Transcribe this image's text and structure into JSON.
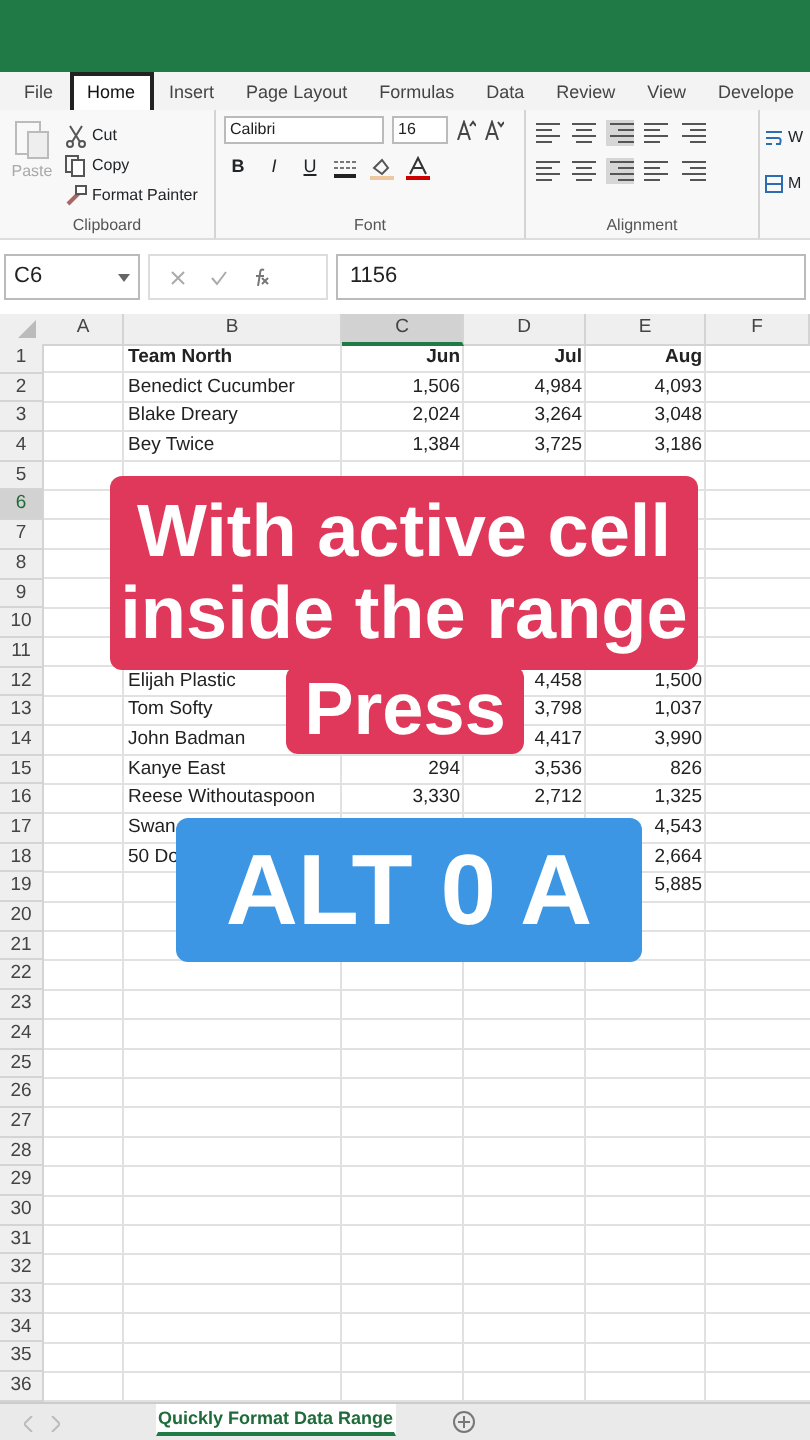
{
  "menu_tabs": [
    {
      "label": "File",
      "selected": false
    },
    {
      "label": "Home",
      "selected": true
    },
    {
      "label": "Insert",
      "selected": false
    },
    {
      "label": "Page Layout",
      "selected": false
    },
    {
      "label": "Formulas",
      "selected": false
    },
    {
      "label": "Data",
      "selected": false
    },
    {
      "label": "Review",
      "selected": false
    },
    {
      "label": "View",
      "selected": false
    },
    {
      "label": "Develope",
      "selected": false
    }
  ],
  "ribbon": {
    "clipboard": {
      "paste": {
        "label": "Paste",
        "disabled": true
      },
      "commands": [
        "Cut",
        "Copy",
        "Format Painter"
      ],
      "label": "Clipboard"
    },
    "font": {
      "font_name": "Calibri",
      "font_size": "16",
      "style_buttons": [
        "B",
        "I",
        "U"
      ],
      "label": "Font"
    },
    "alignment": {
      "label": "Alignment"
    },
    "cut_off_commands": [
      "W",
      "M"
    ]
  },
  "formula_bar": {
    "name_box": "C6",
    "formula": "1156"
  },
  "columns": [
    {
      "label": "A",
      "selected": false
    },
    {
      "label": "B",
      "selected": false
    },
    {
      "label": "C",
      "selected": true
    },
    {
      "label": "D",
      "selected": false
    },
    {
      "label": "E",
      "selected": false
    },
    {
      "label": "F",
      "selected": false
    }
  ],
  "table_header": {
    "number": "1",
    "selected": false,
    "cells": {
      "B": "Team North",
      "C": "Jun",
      "D": "Jul",
      "E": "Aug"
    }
  },
  "rows": [
    {
      "number": "2",
      "selected": false,
      "cells": {
        "B": "Benedict Cucumber",
        "C": "1,506",
        "D": "4,984",
        "E": "4,093"
      }
    },
    {
      "number": "3",
      "selected": false,
      "cells": {
        "B": "Blake Dreary",
        "C": "2,024",
        "D": "3,264",
        "E": "3,048"
      }
    },
    {
      "number": "4",
      "selected": false,
      "cells": {
        "B": "Bey Twice",
        "C": "1,384",
        "D": "3,725",
        "E": "3,186"
      }
    },
    {
      "number": "5",
      "selected": false
    },
    {
      "number": "6",
      "selected": true
    },
    {
      "number": "7",
      "selected": false
    },
    {
      "number": "8",
      "selected": false
    },
    {
      "number": "9",
      "selected": false
    },
    {
      "number": "10",
      "selected": false
    },
    {
      "number": "11",
      "selected": false
    },
    {
      "number": "12",
      "selected": false,
      "cells": {
        "B": "Elijah Plastic",
        "D": "4,458",
        "E": "1,500"
      }
    },
    {
      "number": "13",
      "selected": false,
      "cells": {
        "B": "Tom Softy",
        "D": "3,798",
        "E": "1,037"
      }
    },
    {
      "number": "14",
      "selected": false,
      "cells": {
        "B": "John Badman",
        "D": "4,417",
        "E": "3,990"
      }
    },
    {
      "number": "15",
      "selected": false,
      "cells": {
        "B": "Kanye East",
        "C": "294",
        "D": "3,536",
        "E": "826"
      }
    },
    {
      "number": "16",
      "selected": false,
      "cells": {
        "B": "Reese Withoutaspoon",
        "C": "3,330",
        "D": "2,712",
        "E": "1,325"
      }
    },
    {
      "number": "17",
      "selected": false,
      "cells": {
        "B": "Swan",
        "E": "4,543"
      }
    },
    {
      "number": "18",
      "selected": false,
      "cells": {
        "B": "50 Do",
        "E": "2,664"
      }
    },
    {
      "number": "19",
      "selected": false,
      "cells": {
        "E": "5,885"
      }
    },
    {
      "number": "20",
      "selected": false
    },
    {
      "number": "21",
      "selected": false
    },
    {
      "number": "22",
      "selected": false
    },
    {
      "number": "23",
      "selected": false
    },
    {
      "number": "24",
      "selected": false
    },
    {
      "number": "25",
      "selected": false
    },
    {
      "number": "26",
      "selected": false
    },
    {
      "number": "27",
      "selected": false
    },
    {
      "number": "28",
      "selected": false
    },
    {
      "number": "29",
      "selected": false
    },
    {
      "number": "30",
      "selected": false
    },
    {
      "number": "31",
      "selected": false
    },
    {
      "number": "32",
      "selected": false
    },
    {
      "number": "33",
      "selected": false
    },
    {
      "number": "34",
      "selected": false
    },
    {
      "number": "35",
      "selected": false
    },
    {
      "number": "36",
      "selected": false
    }
  ],
  "sheet_tabs": [
    {
      "label": "Quickly Format Data Range",
      "selected": true
    }
  ],
  "captions": [
    {
      "lines": [
        "With active cell",
        "inside the range"
      ],
      "color": "#e0385a"
    },
    {
      "lines": [
        "Press"
      ],
      "color": "#e0385a"
    },
    {
      "lines": [
        "ALT 0 A"
      ],
      "color": "#3d96e3"
    }
  ]
}
